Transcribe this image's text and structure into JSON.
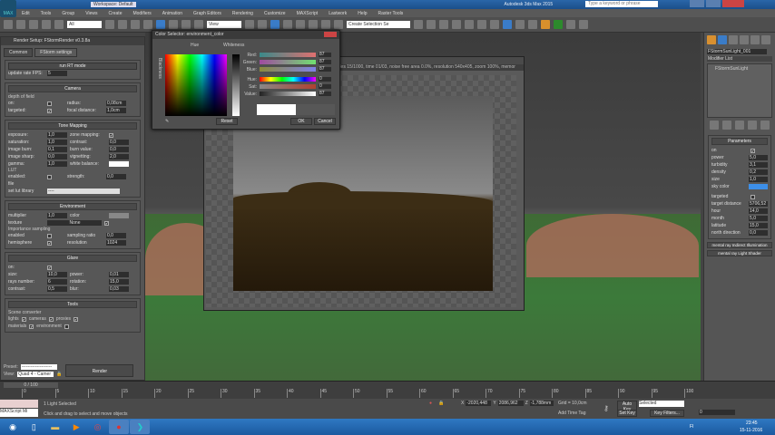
{
  "app": {
    "title": "Workspace: Default",
    "title_right": "Autodesk 3ds Max 2015",
    "search_placeholder": "Type a keyword or phrase",
    "logo": "MAX"
  },
  "menu": [
    "Edit",
    "Tools",
    "Group",
    "Views",
    "Create",
    "Modifiers",
    "Animation",
    "Graph Editors",
    "Rendering",
    "Customize",
    "MAXScript",
    "Lastwork",
    "Help",
    "Raster Tools"
  ],
  "toolbar": {
    "selection_filter": "All",
    "ref_coord": "View",
    "named_sel": "Create Selection Se"
  },
  "render_setup": {
    "title": "Render Setup: FStormRender v0.3.8a",
    "tabs": [
      "Common",
      "FStorm settings"
    ],
    "rt_button": "run RT mode",
    "update_rate_label": "update rate FPS:",
    "update_rate": "5",
    "camera": {
      "header": "Camera",
      "dof_label": "depth of field",
      "on_label": "on:",
      "targeted_label": "targeted:",
      "radius_label": "radius:",
      "radius": "0,08cm",
      "focal_label": "focal distance:",
      "focal": "1,0cm"
    },
    "tone": {
      "header": "Tone Mapping",
      "rows": [
        [
          "exposure:",
          "1,0",
          "zone mapping:",
          ""
        ],
        [
          "saturation:",
          "1,0",
          "contrast:",
          "0,0"
        ],
        [
          "image burn:",
          "0,1",
          "burn value:",
          "0,0"
        ],
        [
          "image sharp:",
          "0,0",
          "vignetting:",
          "2,0"
        ],
        [
          "gamma:",
          "1,0",
          "white balance:",
          ""
        ]
      ],
      "lut_label": "LUT",
      "enabled_label": "enabled:",
      "strength_label": "strength:",
      "strength": "0,0",
      "file_label": "file",
      "set_lut_label": "set lut library",
      "lut_value": "----"
    },
    "environment": {
      "header": "Environment",
      "multiplier_label": "multiplier",
      "multiplier": "1,0",
      "color_label": "color",
      "texture_label": "texture",
      "texture_value": "None",
      "is_label": "Importance sampling",
      "enabled_label": "enabled",
      "sampling_label": "sampling ratio",
      "sampling": "0,0",
      "hemisphere_label": "hemisphere",
      "resolution_label": "resolution",
      "resolution": "1024"
    },
    "glare": {
      "header": "Glare",
      "on_label": "on:",
      "size_label": "size:",
      "size": "10,0",
      "power_label": "power:",
      "power": "0,01",
      "rays_label": "rays number:",
      "rays": "6",
      "rotation_label": "rotation:",
      "rotation": "15,0",
      "contrast_label": "contrast:",
      "contrast": "0,5",
      "blur_label": "blur:",
      "blur": "0,03"
    },
    "tools": {
      "header": "Tools",
      "sc_label": "Scene converter",
      "lights": "lights",
      "cameras": "cameras",
      "proxies": "proxies",
      "materials": "materials",
      "environment": "environment"
    },
    "preset_label": "Preset:",
    "preset_value": "--------------------",
    "view_label": "View:",
    "view_value": "Quad 4 - Camer",
    "render_button": "Render"
  },
  "color_selector": {
    "title": "Color Selector: environment_color",
    "hue_label": "Hue",
    "whiteness_label": "Whiteness",
    "blackness_label": "Blackness",
    "rows": [
      {
        "label": "Red:",
        "value": "87"
      },
      {
        "label": "Green:",
        "value": "87"
      },
      {
        "label": "Blue:",
        "value": "87"
      },
      {
        "label": "Hue:",
        "value": "0"
      },
      {
        "label": "Sat:",
        "value": "0"
      },
      {
        "label": "Value:",
        "value": "87"
      }
    ],
    "reset": "Reset",
    "ok": "OK",
    "cancel": "Cancel"
  },
  "render_window": {
    "status": "rples 15/1000, time 01/03, noise free area 0.0%, resolution 540x405, zoom 100%, memor"
  },
  "command_panel": {
    "object_name": "FStormSunLight_001",
    "modifier_list": "Modifier List",
    "stack_item": "FStormSunLight",
    "params_header": "Parameters",
    "params": [
      {
        "label": "on",
        "value": "✔"
      },
      {
        "label": "power",
        "value": "5,0"
      },
      {
        "label": "turbidity",
        "value": "3,1"
      },
      {
        "label": "density",
        "value": "0,2"
      },
      {
        "label": "size",
        "value": "1,0"
      },
      {
        "label": "sky color",
        "value": ""
      },
      {
        "label": "targeted",
        "value": ""
      },
      {
        "label": "target distance",
        "value": "5706,52"
      },
      {
        "label": "hour",
        "value": "14,0"
      },
      {
        "label": "month",
        "value": "5,0"
      },
      {
        "label": "latitude",
        "value": "15,0"
      },
      {
        "label": "north direction",
        "value": "0,0"
      }
    ],
    "rollouts": [
      "mental ray Indirect Illumination",
      "mental ray Light Shader"
    ],
    "sky_color": "#3d8fe8"
  },
  "timeline": {
    "frame": "0 / 100",
    "ticks": [
      "0",
      "5",
      "10",
      "15",
      "20",
      "25",
      "30",
      "35",
      "40",
      "45",
      "50",
      "55",
      "60",
      "65",
      "70",
      "75",
      "80",
      "85",
      "90",
      "95",
      "100"
    ]
  },
  "status": {
    "maxscript": "MAXScript Mi",
    "selected": "1 Light Selected",
    "prompt": "Click and drag to select and move objects",
    "x": "-2020,448",
    "y": "2086,962",
    "z": "-1,788mm",
    "grid": "Grid = 10,0cm",
    "add_time_tag": "Add Time Tag",
    "auto_key": "Auto Key",
    "key_mode": "Selected",
    "set_key": "Set Key",
    "key_filters": "Key Filters...",
    "frame_field": "0"
  },
  "taskbar": {
    "lang": "FI",
    "time": "23:45",
    "date": "15-11-2016"
  }
}
